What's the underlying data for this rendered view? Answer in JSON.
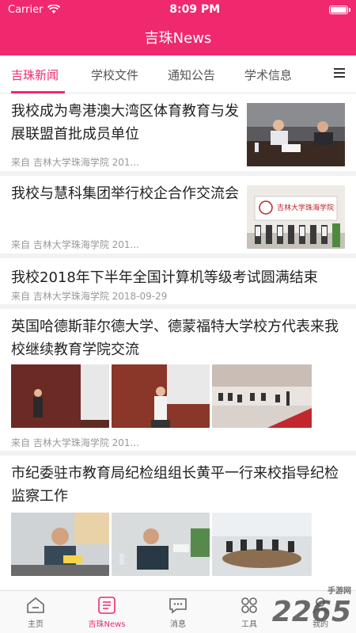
{
  "status": {
    "carrier": "Carrier",
    "time": "8:09 PM"
  },
  "nav": {
    "title": "吉珠News"
  },
  "tabs": [
    {
      "label": "吉珠新闻",
      "active": true
    },
    {
      "label": "学校文件",
      "active": false
    },
    {
      "label": "通知公告",
      "active": false
    },
    {
      "label": "学术信息",
      "active": false
    }
  ],
  "news": [
    {
      "title": "我校成为粤港澳大湾区体育教育与发展联盟首批成员单位",
      "source": "来自 吉林大学珠海学院 201..."
    },
    {
      "title": "我校与慧科集团举行校企合作交流会",
      "source": "来自 吉林大学珠海学院 201...",
      "banner": "吉林大学珠海学院"
    },
    {
      "title": "我校2018年下半年全国计算机等级考试圆满结束",
      "source": "来自 吉林大学珠海学院 2018-09-29"
    },
    {
      "title": "英国哈德斯菲尔德大学、德蒙福特大学校方代表来我校继续教育学院交流",
      "source": "来自 吉林大学珠海学院 201..."
    },
    {
      "title": "市纪委驻市教育局纪检组组长黄平一行来校指导纪检监察工作"
    }
  ],
  "tabbar": [
    {
      "label": "主页",
      "icon": "home-icon",
      "active": false
    },
    {
      "label": "吉珠News",
      "icon": "news-icon",
      "active": true
    },
    {
      "label": "消息",
      "icon": "message-icon",
      "active": false
    },
    {
      "label": "工具",
      "icon": "tools-icon",
      "active": false
    },
    {
      "label": "我的",
      "icon": "profile-icon",
      "active": false
    }
  ],
  "watermark": {
    "brand": "2265",
    "sub": "手游网",
    "domain": ".com"
  },
  "colors": {
    "accent": "#f0286e"
  }
}
